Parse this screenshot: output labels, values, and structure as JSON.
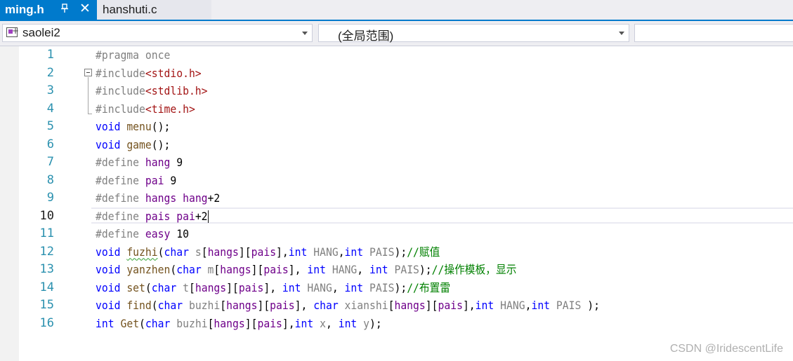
{
  "tabs": [
    {
      "label": "ming.h",
      "active": true,
      "pin_icon": "pin-icon",
      "close_icon": "close-icon"
    },
    {
      "label": "hanshuti.c",
      "active": false
    }
  ],
  "navbar": {
    "project_combo": "saolei2",
    "scope_combo": "(全局范围)",
    "member_combo": ""
  },
  "current_line": 10,
  "line_numbers": [
    "1",
    "2",
    "3",
    "4",
    "5",
    "6",
    "7",
    "8",
    "9",
    "10",
    "11",
    "12",
    "13",
    "14",
    "15",
    "16"
  ],
  "code": [
    [
      [
        "pp",
        "#pragma once"
      ]
    ],
    [
      [
        "pp",
        "#include"
      ],
      [
        "brk",
        "<"
      ],
      [
        "inc",
        "stdio.h"
      ],
      [
        "brk",
        ">"
      ]
    ],
    [
      [
        "pp",
        "#include"
      ],
      [
        "brk",
        "<"
      ],
      [
        "inc",
        "stdlib.h"
      ],
      [
        "brk",
        ">"
      ]
    ],
    [
      [
        "pp",
        "#include"
      ],
      [
        "brk",
        "<"
      ],
      [
        "inc",
        "time.h"
      ],
      [
        "brk",
        ">"
      ]
    ],
    [
      [
        "kw",
        "void"
      ],
      [
        "txt",
        " "
      ],
      [
        "fn",
        "menu"
      ],
      [
        "txt",
        "();"
      ]
    ],
    [
      [
        "kw",
        "void"
      ],
      [
        "txt",
        " "
      ],
      [
        "fn",
        "game"
      ],
      [
        "txt",
        "();"
      ]
    ],
    [
      [
        "pp",
        "#define"
      ],
      [
        "txt",
        " "
      ],
      [
        "mac",
        "hang"
      ],
      [
        "txt",
        " 9"
      ]
    ],
    [
      [
        "pp",
        "#define"
      ],
      [
        "txt",
        " "
      ],
      [
        "mac",
        "pai"
      ],
      [
        "txt",
        " 9"
      ]
    ],
    [
      [
        "pp",
        "#define"
      ],
      [
        "txt",
        " "
      ],
      [
        "mac",
        "hangs"
      ],
      [
        "txt",
        " "
      ],
      [
        "mac",
        "hang"
      ],
      [
        "txt",
        "+2"
      ]
    ],
    [
      [
        "pp",
        "#define"
      ],
      [
        "txt",
        " "
      ],
      [
        "mac",
        "pais"
      ],
      [
        "txt",
        " "
      ],
      [
        "mac",
        "pai"
      ],
      [
        "txt",
        "+2"
      ]
    ],
    [
      [
        "pp",
        "#define"
      ],
      [
        "txt",
        " "
      ],
      [
        "mac",
        "easy"
      ],
      [
        "txt",
        " 10"
      ]
    ],
    [
      [
        "kw",
        "void"
      ],
      [
        "txt",
        " "
      ],
      [
        "fn squiggle",
        "fuzhi"
      ],
      [
        "txt",
        "("
      ],
      [
        "kw",
        "char"
      ],
      [
        "txt",
        " "
      ],
      [
        "par",
        "s"
      ],
      [
        "txt",
        "["
      ],
      [
        "mac",
        "hangs"
      ],
      [
        "txt",
        "]["
      ],
      [
        "mac",
        "pais"
      ],
      [
        "txt",
        "],"
      ],
      [
        "kw",
        "int"
      ],
      [
        "txt",
        " "
      ],
      [
        "par",
        "HANG"
      ],
      [
        "txt",
        ","
      ],
      [
        "kw",
        "int"
      ],
      [
        "txt",
        " "
      ],
      [
        "par",
        "PAIS"
      ],
      [
        "txt",
        ");"
      ],
      [
        "cmt",
        "//赋值"
      ]
    ],
    [
      [
        "kw",
        "void"
      ],
      [
        "txt",
        " "
      ],
      [
        "fn",
        "yanzhen"
      ],
      [
        "txt",
        "("
      ],
      [
        "kw",
        "char"
      ],
      [
        "txt",
        " "
      ],
      [
        "par",
        "m"
      ],
      [
        "txt",
        "["
      ],
      [
        "mac",
        "hangs"
      ],
      [
        "txt",
        "]["
      ],
      [
        "mac",
        "pais"
      ],
      [
        "txt",
        "], "
      ],
      [
        "kw",
        "int"
      ],
      [
        "txt",
        " "
      ],
      [
        "par",
        "HANG"
      ],
      [
        "txt",
        ", "
      ],
      [
        "kw",
        "int"
      ],
      [
        "txt",
        " "
      ],
      [
        "par",
        "PAIS"
      ],
      [
        "txt",
        ");"
      ],
      [
        "cmt",
        "//操作模板，显示"
      ]
    ],
    [
      [
        "kw",
        "void"
      ],
      [
        "txt",
        " "
      ],
      [
        "fn",
        "set"
      ],
      [
        "txt",
        "("
      ],
      [
        "kw",
        "char"
      ],
      [
        "txt",
        " "
      ],
      [
        "par",
        "t"
      ],
      [
        "txt",
        "["
      ],
      [
        "mac",
        "hangs"
      ],
      [
        "txt",
        "]["
      ],
      [
        "mac",
        "pais"
      ],
      [
        "txt",
        "], "
      ],
      [
        "kw",
        "int"
      ],
      [
        "txt",
        " "
      ],
      [
        "par",
        "HANG"
      ],
      [
        "txt",
        ", "
      ],
      [
        "kw",
        "int"
      ],
      [
        "txt",
        " "
      ],
      [
        "par",
        "PAIS"
      ],
      [
        "txt",
        ");"
      ],
      [
        "cmt",
        "//布置雷"
      ]
    ],
    [
      [
        "kw",
        "void"
      ],
      [
        "txt",
        " "
      ],
      [
        "fn",
        "find"
      ],
      [
        "txt",
        "("
      ],
      [
        "kw",
        "char"
      ],
      [
        "txt",
        " "
      ],
      [
        "par",
        "buzhi"
      ],
      [
        "txt",
        "["
      ],
      [
        "mac",
        "hangs"
      ],
      [
        "txt",
        "]["
      ],
      [
        "mac",
        "pais"
      ],
      [
        "txt",
        "], "
      ],
      [
        "kw",
        "char"
      ],
      [
        "txt",
        " "
      ],
      [
        "par",
        "xianshi"
      ],
      [
        "txt",
        "["
      ],
      [
        "mac",
        "hangs"
      ],
      [
        "txt",
        "]["
      ],
      [
        "mac",
        "pais"
      ],
      [
        "txt",
        "],"
      ],
      [
        "kw",
        "int"
      ],
      [
        "txt",
        " "
      ],
      [
        "par",
        "HANG"
      ],
      [
        "txt",
        ","
      ],
      [
        "kw",
        "int"
      ],
      [
        "txt",
        " "
      ],
      [
        "par",
        "PAIS"
      ],
      [
        "txt",
        " );"
      ]
    ],
    [
      [
        "kw",
        "int"
      ],
      [
        "txt",
        " "
      ],
      [
        "fn",
        "Get"
      ],
      [
        "txt",
        "("
      ],
      [
        "kw",
        "char"
      ],
      [
        "txt",
        " "
      ],
      [
        "par",
        "buzhi"
      ],
      [
        "txt",
        "["
      ],
      [
        "mac",
        "hangs"
      ],
      [
        "txt",
        "]["
      ],
      [
        "mac",
        "pais"
      ],
      [
        "txt",
        "],"
      ],
      [
        "kw",
        "int"
      ],
      [
        "txt",
        " "
      ],
      [
        "par",
        "x"
      ],
      [
        "txt",
        ", "
      ],
      [
        "kw",
        "int"
      ],
      [
        "txt",
        " "
      ],
      [
        "par",
        "y"
      ],
      [
        "txt",
        ");"
      ]
    ]
  ],
  "watermark": "CSDN @IridescentLife",
  "colors": {
    "accent": "#007acc",
    "keyword": "#0000ff",
    "preprocessor": "#808080",
    "include_path": "#a31515",
    "macro": "#6f008a",
    "function": "#74531f",
    "comment": "#008000",
    "line_number": "#2b91af"
  }
}
